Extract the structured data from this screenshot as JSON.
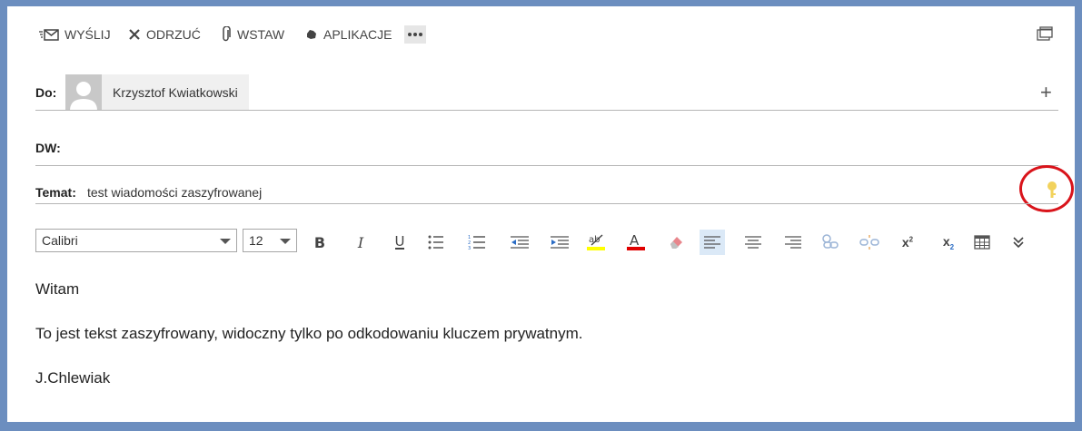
{
  "toolbar": {
    "send_label": "WYŚLIJ",
    "discard_label": "ODRZUĆ",
    "insert_label": "WSTAW",
    "apps_label": "APLIKACJE"
  },
  "to": {
    "label": "Do:",
    "recipient": "Krzysztof Kwiatkowski"
  },
  "cc": {
    "label": "DW:"
  },
  "subject": {
    "label": "Temat:",
    "value": "test wiadomości zaszyfrowanej"
  },
  "format": {
    "font": "Calibri",
    "size": "12"
  },
  "message": {
    "lines": [
      "Witam",
      "To jest tekst zaszyfrowany, widoczny tylko po odkodowaniu kluczem prywatnym.",
      "J.Chlewiak"
    ]
  },
  "colors": {
    "highlight": "#ffff00",
    "font_color": "#e00000",
    "annotation": "#d9141b",
    "key": "#f2d25c"
  },
  "icons": [
    "send-icon",
    "discard-icon",
    "paperclip-icon",
    "apps-icon",
    "more-icon",
    "popout-icon",
    "add-recipient-icon",
    "key-icon"
  ]
}
